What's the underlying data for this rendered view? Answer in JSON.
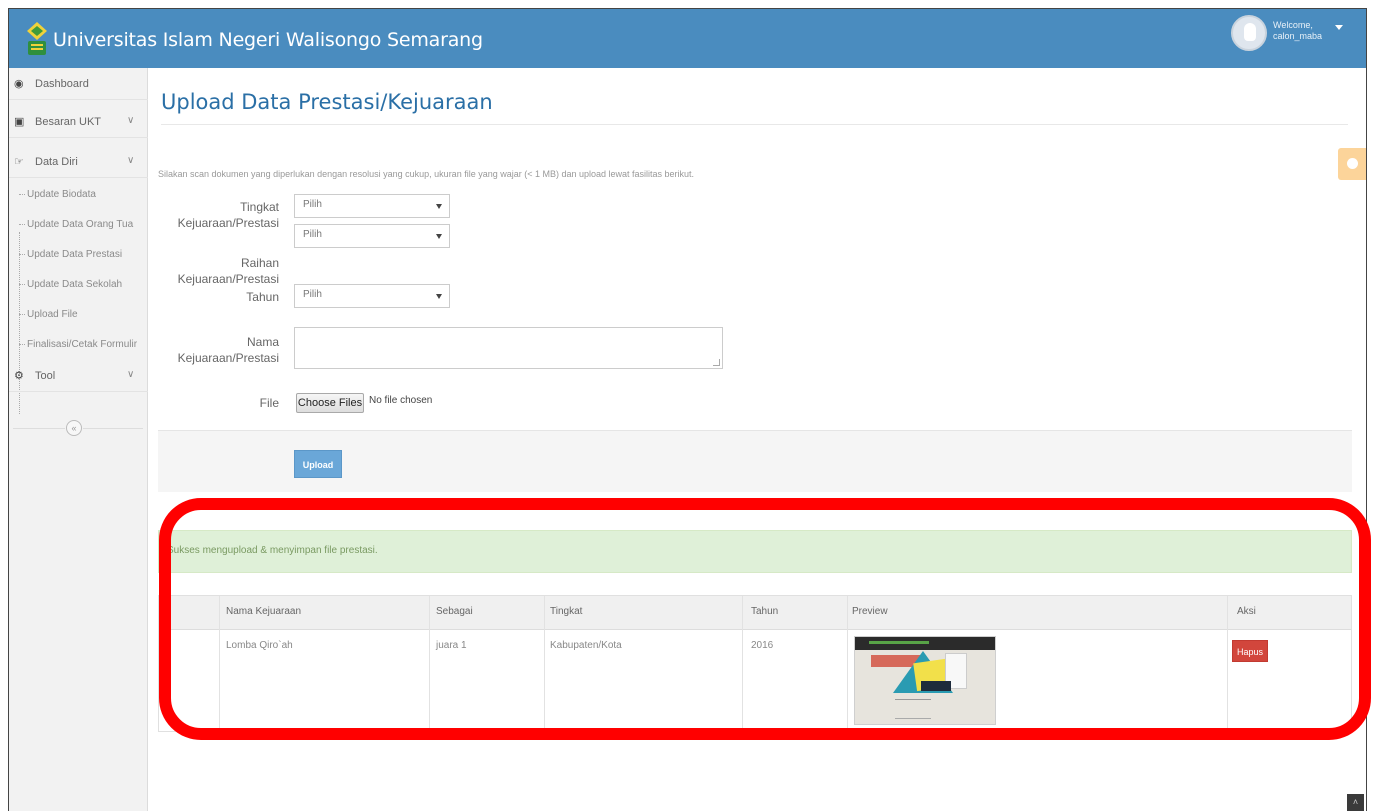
{
  "header": {
    "title": "Universitas Islam Negeri Walisongo Semarang",
    "welcome": "Welcome,",
    "username": "calon_maba",
    "logo_icon": "uin-walisongo-logo",
    "avatar_icon": "user-avatar"
  },
  "sidebar": {
    "items": [
      {
        "label": "Dashboard",
        "icon": "dashboard-icon"
      },
      {
        "label": "Besaran UKT",
        "icon": "money-icon"
      },
      {
        "label": "Data Diri",
        "icon": "hand-pointer-icon"
      },
      {
        "label": "Tool",
        "icon": "cogs-icon"
      }
    ],
    "subitems": [
      {
        "label": "Update Biodata"
      },
      {
        "label": "Update Data Orang Tua"
      },
      {
        "label": "Update Data Prestasi"
      },
      {
        "label": "Update Data Sekolah"
      },
      {
        "label": "Upload File"
      },
      {
        "label": "Finalisasi/Cetak Formulir"
      }
    ],
    "collapse_symbol": "«"
  },
  "page": {
    "title": "Upload Data Prestasi/Kejuaraan",
    "description": "Silakan scan dokumen yang diperlukan dengan resolusi yang cukup, ukuran file yang wajar (< 1 MB) dan upload lewat fasilitas berikut."
  },
  "form": {
    "tingkat_label_1": "Tingkat",
    "tingkat_label_2": "Kejuaraan/Prestasi",
    "tingkat_value": "Pilih",
    "raihan_label_1": "Raihan",
    "raihan_label_2": "Kejuaraan/Prestasi",
    "raihan_value": "Pilih",
    "tahun_label": "Tahun",
    "tahun_value": "Pilih",
    "nama_label_1": "Nama",
    "nama_label_2": "Kejuaraan/Prestasi",
    "nama_value": "",
    "file_label": "File",
    "choose_button": "Choose Files",
    "no_file": "No file chosen",
    "upload_button": "Upload"
  },
  "alert": {
    "message": "Sukses mengupload & menyimpan file prestasi."
  },
  "table": {
    "headers": [
      "Nama Kejuaraan",
      "Sebagai",
      "Tingkat",
      "Tahun",
      "Preview",
      "Aksi"
    ],
    "rows": [
      {
        "nama": "Lomba Qiro`ah",
        "sebagai": "juara 1",
        "tingkat": "Kabupaten/Kota",
        "tahun": "2016",
        "aksi": "Hapus"
      }
    ]
  },
  "colors": {
    "header_bg": "#4a8cbf",
    "title_blue": "#2a6fa6",
    "alert_bg": "#dff0d8",
    "hapus_red": "#d2463c",
    "highlight": "#ff0000"
  }
}
